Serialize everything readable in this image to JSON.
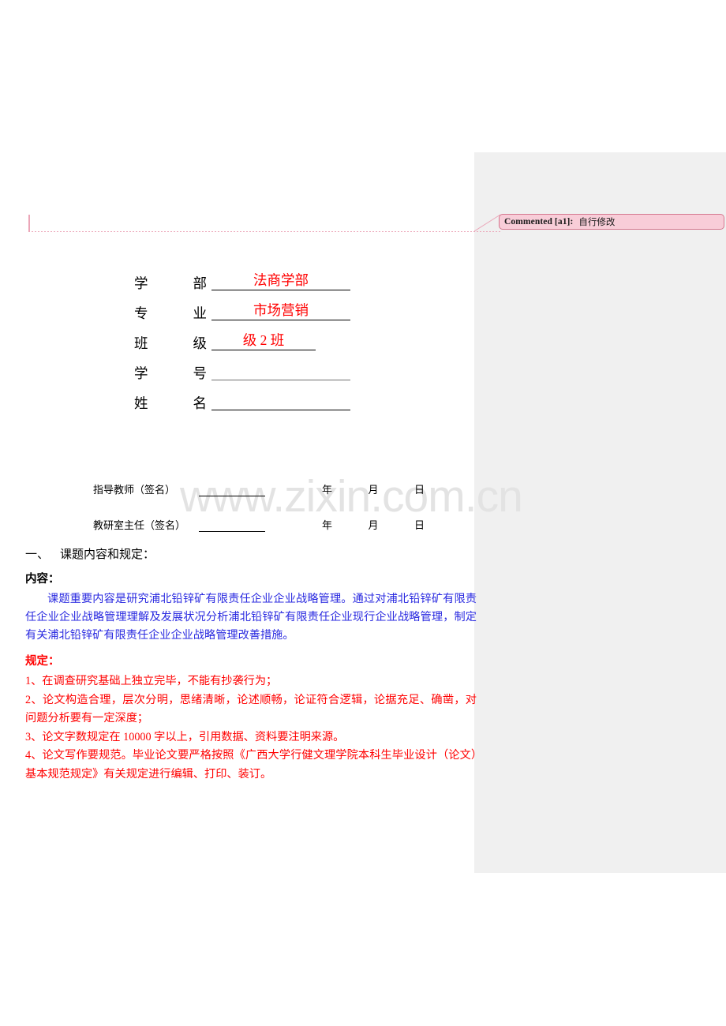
{
  "comment": {
    "label": "Commented [a1]:",
    "text": "自行修改"
  },
  "watermark": {
    "text": "www.zixin.com.cn"
  },
  "cover_form": {
    "rows": [
      {
        "label_left": "学",
        "label_right": "部",
        "value": "法商学部",
        "line": "long"
      },
      {
        "label_left": "专",
        "label_right": "业",
        "value": "市场营销",
        "line": "long"
      },
      {
        "label_left": "班",
        "label_right": "级",
        "value": "级 2 班",
        "line": "short"
      },
      {
        "label_left": "学",
        "label_right": "号",
        "value": "",
        "line": "long"
      },
      {
        "label_left": "姓",
        "label_right": "名",
        "value": "",
        "line": "long"
      }
    ]
  },
  "signatures": {
    "rows": [
      {
        "title": "指导教师（签名）",
        "year": "年",
        "month": "月",
        "day": "日"
      },
      {
        "title": "教研室主任（签名）",
        "year": "年",
        "month": "月",
        "day": "日"
      }
    ]
  },
  "body": {
    "section_number": "一、",
    "section_title": "课题内容和规定：",
    "content_heading": "内容：",
    "content_paragraph": "课题重要内容是研究浦北铅锌矿有限责任企业企业战略管理。通过对浦北铅锌矿有限责任企业企业战略管理理解及发展状况分析浦北铅锌矿有限责任企业现行企业战略管理，制定有关浦北铅锌矿有限责任企业企业战略管理改善措施。",
    "requirements_heading": "规定：",
    "requirements": [
      "1、在调查研究基础上独立完毕，不能有抄袭行为；",
      "2、论文构造合理，层次分明，思绪清晰，论述顺畅，论证符合逻辑，论据充足、确凿，对问题分析要有一定深度；",
      "3、论文字数规定在 10000 字以上，引用数据、资料要注明来源。",
      "4、论文写作要规范。毕业论文要严格按照《广西大学行健文理学院本科生毕业设计（论文）基本规范规定》有关规定进行编辑、打印、装订。"
    ]
  },
  "colors": {
    "blue_text": "#2a2ae0",
    "red_text": "#ff0000",
    "comment_fill": "#f8cdd8",
    "comment_border": "#d4788f",
    "pane_bg": "#f0f0f0",
    "watermark": "#e3e3e3"
  }
}
